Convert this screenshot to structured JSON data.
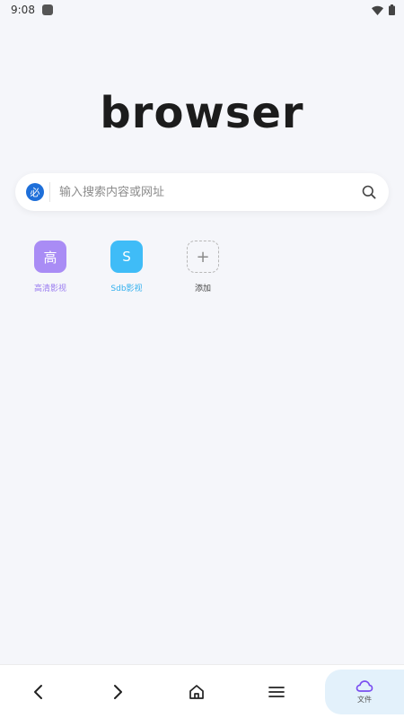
{
  "status_bar": {
    "time": "9:08"
  },
  "logo": {
    "text": "browser"
  },
  "search": {
    "engine_label": "必",
    "placeholder": "输入搜索内容或网址"
  },
  "shortcuts": [
    {
      "tile_text": "高",
      "label": "高清影视",
      "color": "#a98cf5"
    },
    {
      "tile_text": "S",
      "label": "Sdb影视",
      "color": "#3fbcf7"
    },
    {
      "tile_text": "+",
      "label": "添加",
      "color": "#b8b8b8"
    }
  ],
  "bottom_nav": {
    "back_icon": "chevron-left-icon",
    "forward_icon": "chevron-right-icon",
    "home_icon": "home-icon",
    "menu_icon": "menu-icon",
    "files_label": "文件",
    "files_icon": "cloud-icon"
  },
  "colors": {
    "accent_purple": "#7a4ef0",
    "accent_blue": "#1e6fd9",
    "files_bg": "#e3f1fb"
  }
}
